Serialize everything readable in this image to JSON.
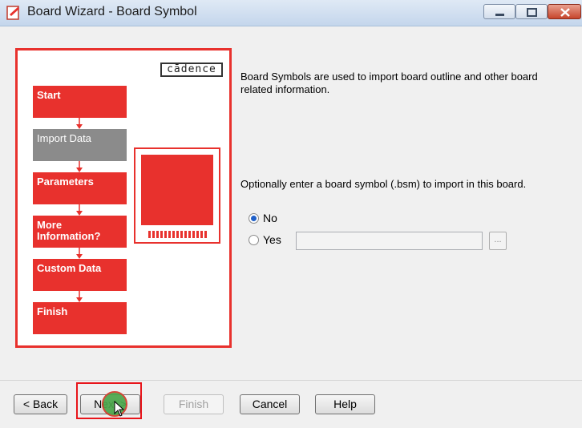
{
  "window": {
    "title": "Board Wizard - Board Symbol"
  },
  "logo": {
    "text": "cādence"
  },
  "steps": [
    {
      "label": "Start"
    },
    {
      "label": "Import Data"
    },
    {
      "label": "Parameters"
    },
    {
      "label": "More Information?"
    },
    {
      "label": "Custom Data"
    },
    {
      "label": "Finish"
    }
  ],
  "content": {
    "description": "Board Symbols are used to import board outline and other board related information.",
    "prompt": "Optionally enter a board symbol (.bsm) to import in this board."
  },
  "options": {
    "no_label": "No",
    "yes_label": "Yes",
    "selected": "No",
    "path_value": "",
    "browse_label": "..."
  },
  "buttons": {
    "back": "< Back",
    "next": "Next >",
    "finish": "Finish",
    "cancel": "Cancel",
    "help": "Help"
  },
  "colors": {
    "accent": "#e8312d",
    "active_step": "#8b8b8b",
    "radio_selected": "#1f5fc8"
  }
}
